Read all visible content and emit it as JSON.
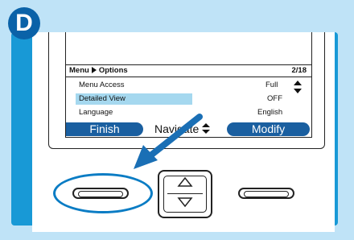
{
  "step_badge": "D",
  "screen": {
    "breadcrumb_parent": "Menu",
    "breadcrumb_child": "Options",
    "page_indicator": "2/18",
    "rows": [
      {
        "label": "Menu Access",
        "value": "Full"
      },
      {
        "label": "Detailed View",
        "value": "OFF"
      },
      {
        "label": "Language",
        "value": "English"
      }
    ],
    "softkeys": {
      "left": "Finish",
      "middle": "Navigate",
      "right": "Modify"
    }
  },
  "colors": {
    "background": "#bfe3f7",
    "panel": "#1899d6",
    "badge": "#0a62a8",
    "softkey": "#1a5fa0",
    "highlight": "#a5d8ef",
    "callout": "#0a7cc4"
  },
  "icons": {
    "breadcrumb_separator": "triangle-right-icon",
    "scroll": "up-down-arrows-icon",
    "pointer": "arrow-icon",
    "nav_up": "up-triangle-icon",
    "nav_down": "down-triangle-icon"
  }
}
